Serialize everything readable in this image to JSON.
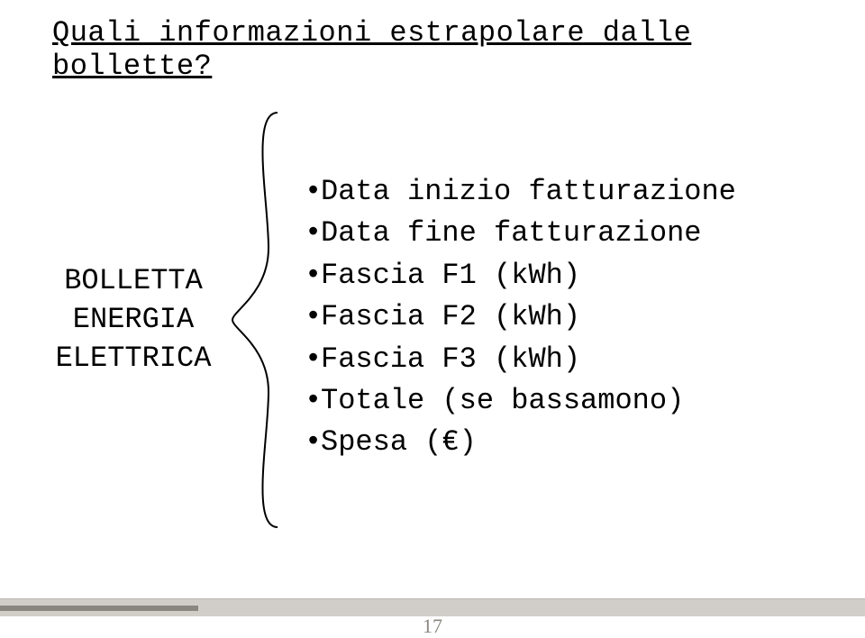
{
  "title": "Quali informazioni estrapolare dalle bollette?",
  "left_label": {
    "line1": "BOLLETTA",
    "line2": "ENERGIA",
    "line3": "ELETTRICA"
  },
  "bullets": [
    "Data inizio fatturazione",
    "Data fine fatturazione",
    "Fascia F1 (kWh)",
    "Fascia F2 (kWh)",
    "Fascia F3 (kWh)",
    "Totale (se bassamono)",
    "Spesa (€)"
  ],
  "page_number": "17"
}
